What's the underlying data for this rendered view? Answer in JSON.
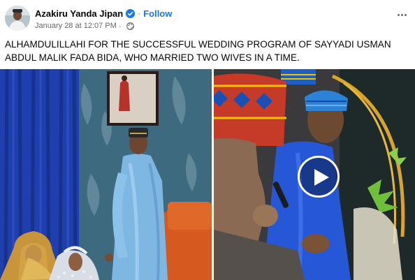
{
  "post": {
    "author": "Azakiru Yanda Jipan",
    "follow_label": "Follow",
    "separator": "·",
    "timestamp": "January 28 at 12:07 PM",
    "audience_icon": "globe-icon",
    "caption": "ALHAMDULILLAHI FOR THE SUCCESSFUL WEDDING PROGRAM OF SAYYADI USMAN ABDUL MALIK FADA BIDA, WHO MARRIED TWO WIVES IN A TIME."
  },
  "icons": {
    "verified": "verified-badge-icon",
    "more": "more-options-icon",
    "play": "play-icon"
  },
  "colors": {
    "accent": "#1877f2",
    "text": "#050505",
    "secondary_text": "#65676b"
  }
}
